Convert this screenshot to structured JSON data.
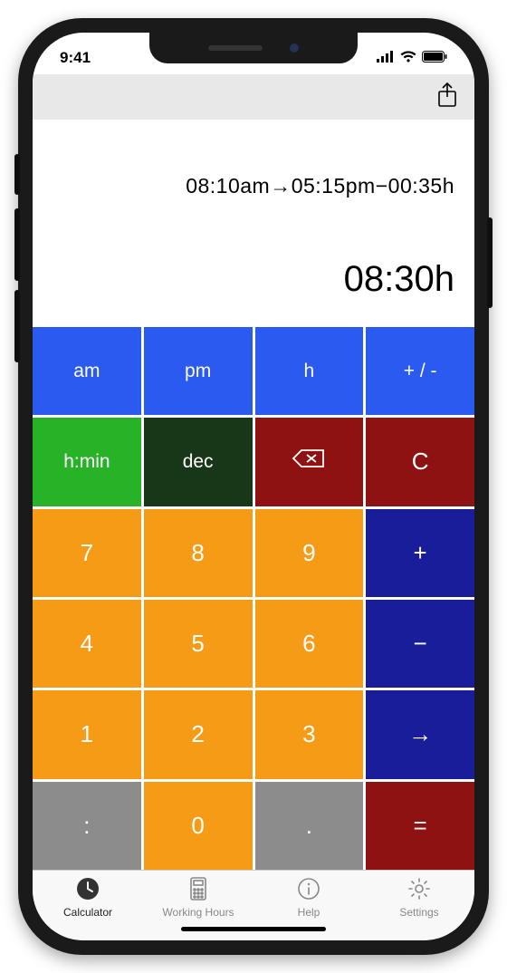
{
  "status": {
    "time": "9:41"
  },
  "display": {
    "expression": "08:10am→05:15pm−00:35h",
    "result": "08:30h"
  },
  "keys": {
    "am": "am",
    "pm": "pm",
    "h": "h",
    "plusminus": "+ / -",
    "hmin": "h:min",
    "dec": "dec",
    "clear": "C",
    "k7": "7",
    "k8": "8",
    "k9": "9",
    "plus": "+",
    "k4": "4",
    "k5": "5",
    "k6": "6",
    "minus": "−",
    "k1": "1",
    "k2": "2",
    "k3": "3",
    "arrow": "→",
    "colon": ":",
    "k0": "0",
    "dot": ".",
    "equals": "="
  },
  "tabs": {
    "calculator": "Calculator",
    "working_hours": "Working Hours",
    "help": "Help",
    "settings": "Settings"
  }
}
